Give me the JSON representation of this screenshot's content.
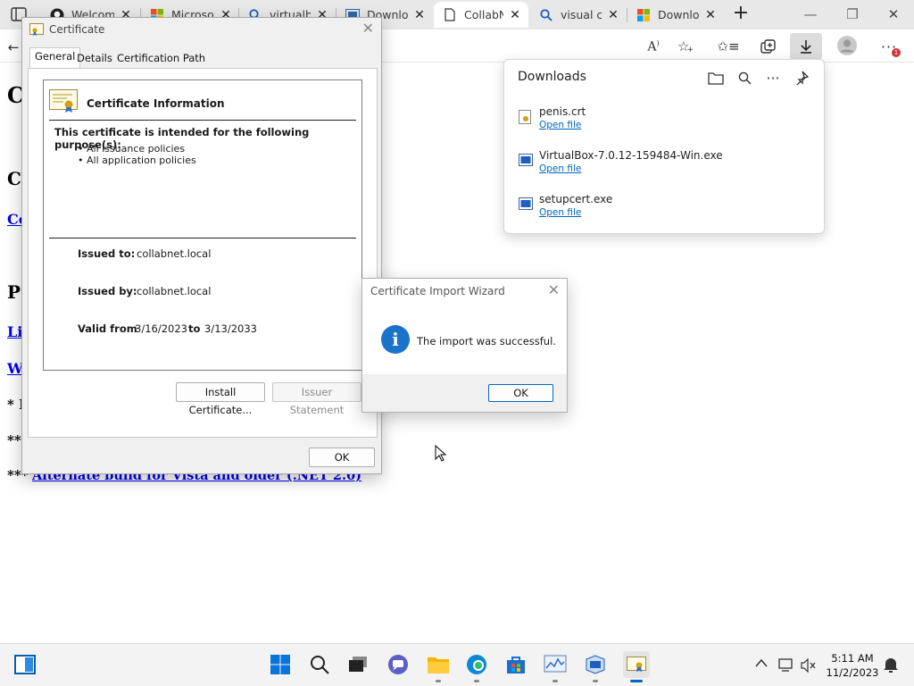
{
  "browser": {
    "tabs": [
      {
        "title": "Welcome",
        "icon": "github-icon"
      },
      {
        "title": "Microsoft",
        "icon": "microsoft-icon"
      },
      {
        "title": "virtualbox",
        "icon": "search-icon"
      },
      {
        "title": "Download",
        "icon": "virtualbox-icon"
      },
      {
        "title": "CollabNet",
        "icon": "page-icon"
      },
      {
        "title": "visual c++",
        "icon": "search-icon"
      },
      {
        "title": "Download",
        "icon": "microsoft-icon"
      }
    ],
    "active_tab_index": 4,
    "new_tab_label": "+",
    "toolbar_icons": [
      "read-aloud-icon",
      "add-favorite-icon",
      "favorites-icon",
      "collections-icon",
      "downloads-icon",
      "profile-icon",
      "more-icon"
    ],
    "notification_count": "1"
  },
  "page": {
    "heading_fragment_1": "C",
    "heading_fragment_2": "C",
    "link_fragment_1": "Co",
    "heading_fragment_3": "P",
    "link_fragment_2": "Li",
    "link_fragment_3": "W",
    "text_fragment_1": "* I",
    "text_fragment_2": "**",
    "bottom_prefix": "***",
    "bottom_link": "Alternate build for Vista and older (.NET 2.0)"
  },
  "certificate_dialog": {
    "title": "Certificate",
    "tabs": [
      "General",
      "Details",
      "Certification Path"
    ],
    "info_heading": "Certificate Information",
    "purpose_heading": "This certificate is intended for the following purpose(s):",
    "purposes": [
      "• All issuance policies",
      "• All application policies"
    ],
    "issued_to_label": "Issued to:",
    "issued_to": "collabnet.local",
    "issued_by_label": "Issued by:",
    "issued_by": "collabnet.local",
    "valid_from_label": "Valid from",
    "valid_from": "3/16/2023",
    "to_label": "to",
    "valid_to": "3/13/2033",
    "install_button": "Install Certificate...",
    "issuer_statement_button": "Issuer Statement",
    "ok_button": "OK"
  },
  "downloads": {
    "title": "Downloads",
    "items": [
      {
        "name": "penis.crt",
        "action": "Open file",
        "icon": "certificate-file-icon"
      },
      {
        "name": "VirtualBox-7.0.12-159484-Win.exe",
        "action": "Open file",
        "icon": "exe-file-icon"
      },
      {
        "name": "setupcert.exe",
        "action": "Open file",
        "icon": "exe-file-icon"
      }
    ]
  },
  "import_wizard": {
    "title": "Certificate Import Wizard",
    "message": "The import was successful.",
    "ok_button": "OK"
  },
  "taskbar": {
    "time": "5:11 AM",
    "date": "11/2/2023"
  },
  "colors": {
    "accent": "#0067c0",
    "link": "#0000ee",
    "badge": "#d13438",
    "info_icon": "#1a73c8"
  }
}
